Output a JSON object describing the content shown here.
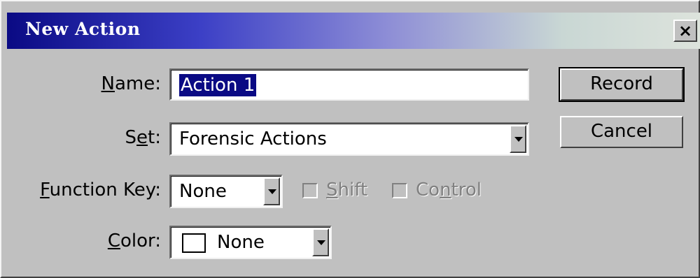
{
  "window": {
    "title": "New Action",
    "close_glyph": "✕"
  },
  "form": {
    "name_label_key": "N",
    "name_label_rest": "ame:",
    "name_value": "Action 1",
    "set_label_pre": "S",
    "set_label_key": "e",
    "set_label_rest": "t:",
    "set_value": "Forensic Actions",
    "function_key_label_key": "F",
    "function_key_label_rest": "unction Key:",
    "function_key_value": "None",
    "shift_label_key": "S",
    "shift_label_rest": "hift",
    "control_label_pre": "Co",
    "control_label_key": "n",
    "control_label_rest": "trol",
    "color_label_key": "C",
    "color_label_rest": "olor:",
    "color_value": "None",
    "color_swatch": "#ffffff"
  },
  "buttons": {
    "record": "Record",
    "cancel": "Cancel"
  },
  "icons": {
    "close": "close-icon",
    "dropdown": "chevron-down-icon"
  }
}
